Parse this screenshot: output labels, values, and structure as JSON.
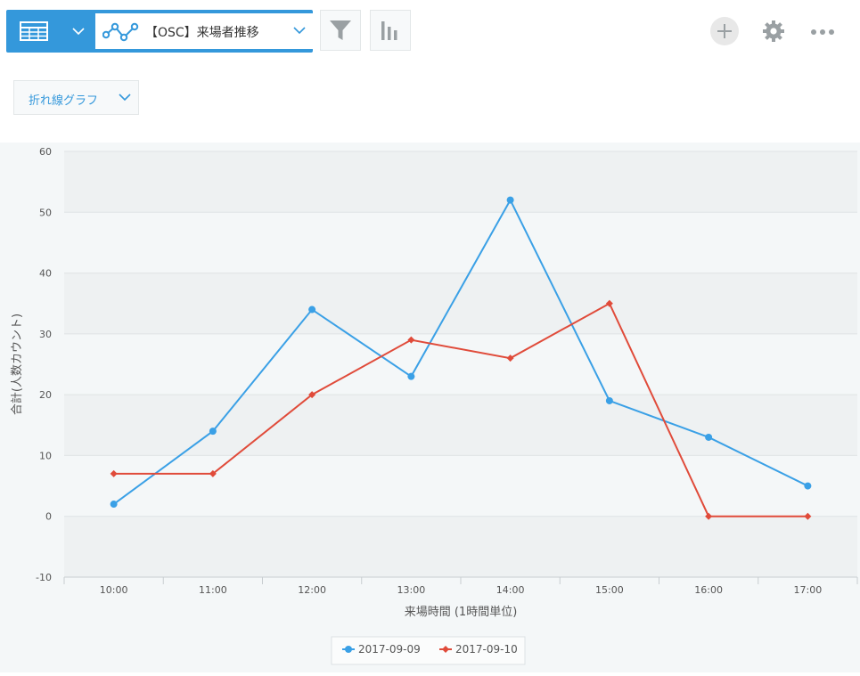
{
  "toolbar": {
    "report_name": "【OSC】来場者推移",
    "view_icon": "table-icon",
    "chart_icon": "line-chart-icon",
    "filter_icon": "filter-icon",
    "graph_icon": "bar-chart-icon",
    "add_icon": "plus-icon",
    "settings_icon": "gear-icon",
    "more_icon": "more-icon",
    "accent_color": "#3498db"
  },
  "chart_type_select": {
    "label": "折れ線グラフ"
  },
  "chart_data": {
    "type": "line",
    "categories": [
      "10:00",
      "11:00",
      "12:00",
      "13:00",
      "14:00",
      "15:00",
      "16:00",
      "17:00"
    ],
    "series": [
      {
        "name": "2017-09-09",
        "values": [
          2,
          14,
          34,
          23,
          52,
          19,
          13,
          5
        ],
        "color": "#3aa0e6",
        "marker": "circle"
      },
      {
        "name": "2017-09-10",
        "values": [
          7,
          7,
          20,
          29,
          26,
          35,
          0,
          0
        ],
        "color": "#e04b3a",
        "marker": "diamond"
      }
    ],
    "xlabel": "来場時間 (1時間単位)",
    "ylabel": "合計(人数カウント)",
    "ylim": [
      -10,
      60
    ],
    "yticks": [
      "-10",
      "0",
      "10",
      "20",
      "30",
      "40",
      "50",
      "60"
    ],
    "grid": true,
    "legend": "bottom-center"
  }
}
